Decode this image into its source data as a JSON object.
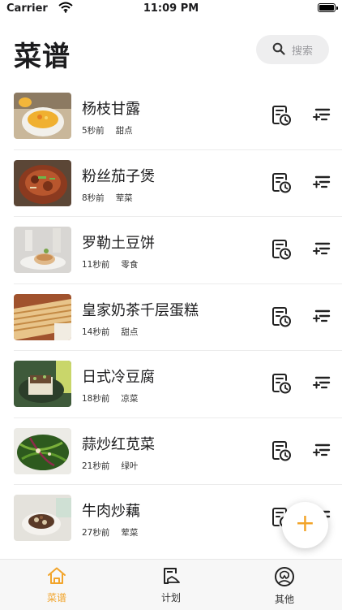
{
  "status_bar": {
    "carrier": "Carrier",
    "time": "11:09 PM"
  },
  "header": {
    "title": "菜谱",
    "search_placeholder": "搜索"
  },
  "recipes": [
    {
      "name": "杨枝甘露",
      "time": "5秒前",
      "category": "甜点"
    },
    {
      "name": "粉丝茄子煲",
      "time": "8秒前",
      "category": "荤菜"
    },
    {
      "name": "罗勒土豆饼",
      "time": "11秒前",
      "category": "零食"
    },
    {
      "name": "皇家奶茶千层蛋糕",
      "time": "14秒前",
      "category": "甜点"
    },
    {
      "name": "日式冷豆腐",
      "time": "18秒前",
      "category": "凉菜"
    },
    {
      "name": "蒜炒红苋菜",
      "time": "21秒前",
      "category": "绿叶"
    },
    {
      "name": "牛肉炒藕",
      "time": "27秒前",
      "category": "荤菜"
    }
  ],
  "fab": {
    "label": "+"
  },
  "tabs": [
    {
      "label": "菜谱",
      "icon": "home-icon",
      "active": true
    },
    {
      "label": "计划",
      "icon": "plan-icon",
      "active": false
    },
    {
      "label": "其他",
      "icon": "other-icon",
      "active": false
    }
  ],
  "colors": {
    "accent": "#f2a42a",
    "search_bg": "#eeeeef",
    "tabbar_bg": "#f7f7f7"
  }
}
